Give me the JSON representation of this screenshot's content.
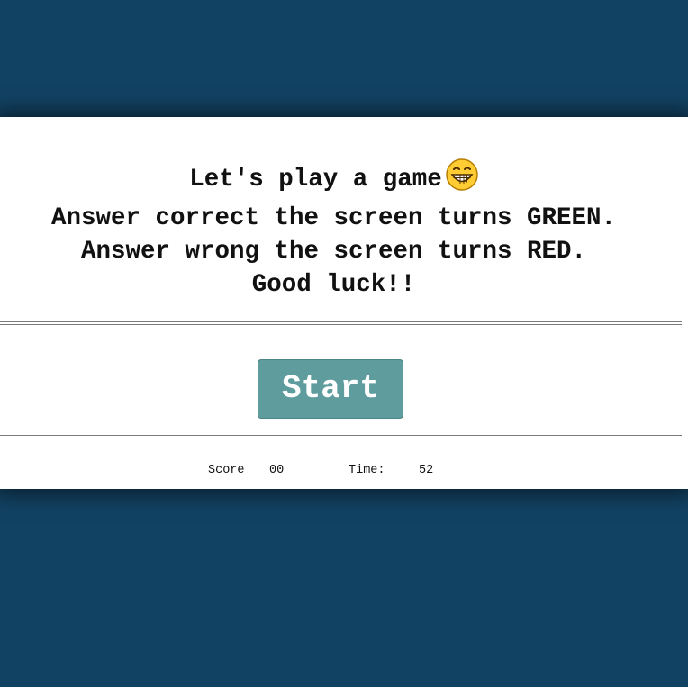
{
  "intro": {
    "line1": "Let's play a game",
    "emoji_icon": "grinning-face-emoji-icon",
    "line2": "Answer correct the screen turns GREEN.",
    "line3": "Answer wrong the screen turns RED.",
    "line4": "Good luck!!"
  },
  "start_button": {
    "label": "Start"
  },
  "stats": {
    "score_label": "Score",
    "score_value": "00",
    "time_label": "Time:",
    "time_value": "52"
  },
  "colors": {
    "background": "#124263",
    "card": "#ffffff",
    "button": "#5f9c9d"
  }
}
